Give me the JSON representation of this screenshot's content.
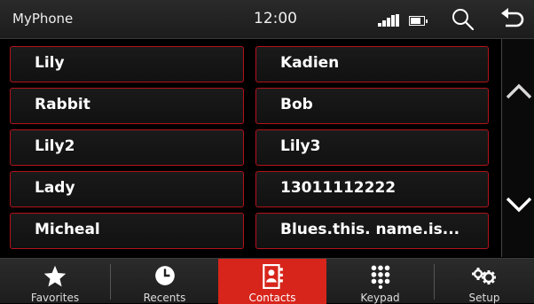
{
  "header": {
    "title": "MyPhone",
    "time": "12:00",
    "icons": [
      "signal-icon",
      "battery-icon",
      "search-icon",
      "back-icon"
    ]
  },
  "contacts": [
    {
      "label": "Lily"
    },
    {
      "label": "Kadien"
    },
    {
      "label": "Rabbit"
    },
    {
      "label": "Bob"
    },
    {
      "label": "Lily2"
    },
    {
      "label": "Lily3"
    },
    {
      "label": "Lady"
    },
    {
      "label": "13011112222"
    },
    {
      "label": "Micheal"
    },
    {
      "label": "Blues.this. name.is..."
    }
  ],
  "scroll": {
    "up_icon": "chevron-up-icon",
    "down_icon": "chevron-down-icon"
  },
  "tabs": [
    {
      "label": "Favorites",
      "icon": "star-icon"
    },
    {
      "label": "Recents",
      "icon": "clock-icon"
    },
    {
      "label": "Contacts",
      "icon": "contact-book-icon",
      "active": true
    },
    {
      "label": "Keypad",
      "icon": "keypad-icon"
    },
    {
      "label": "Setup",
      "icon": "gears-icon"
    }
  ],
  "colors": {
    "accent": "#d7251b",
    "cell_border": "#b3121c",
    "background": "#000000"
  }
}
